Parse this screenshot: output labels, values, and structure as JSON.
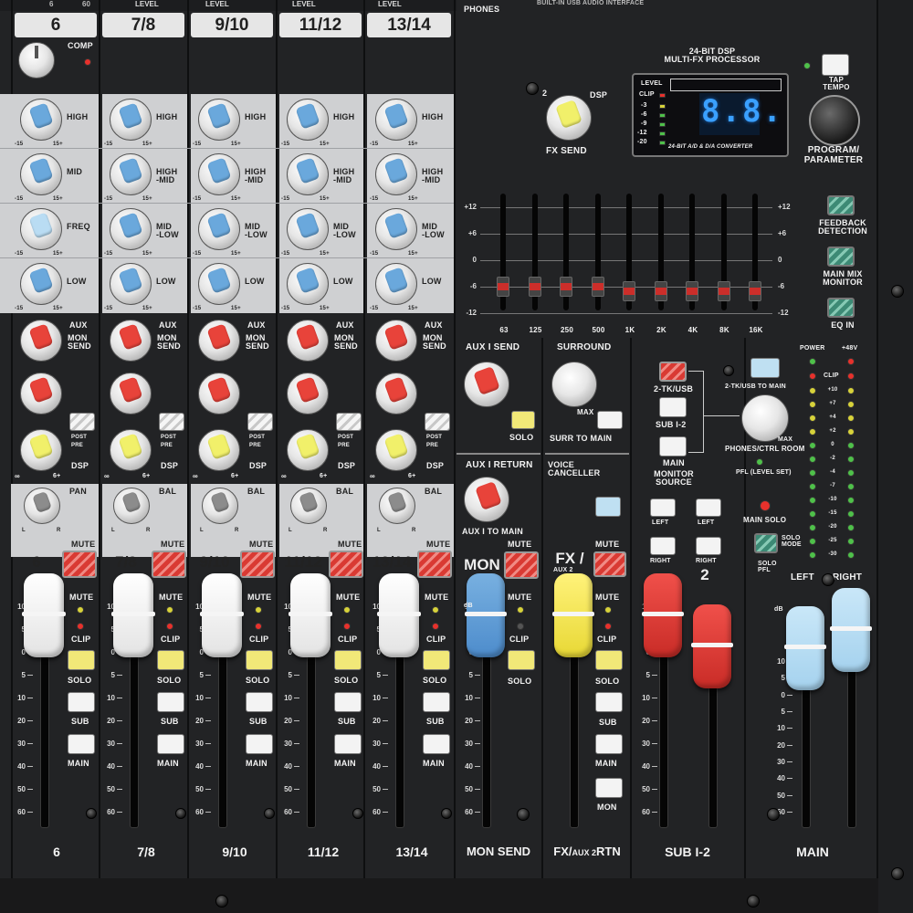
{
  "top": {
    "level_label": "LEVEL",
    "phones_label": "PHONES",
    "usb_label": "BUILT-IN USB AUDIO INTERFACE",
    "top_numbers": [
      "6",
      "60"
    ]
  },
  "channels": [
    {
      "header": "6",
      "number": "6",
      "footer": "6",
      "pan_label": "PAN",
      "pan_hint": "",
      "fader_color": "white"
    },
    {
      "header": "7/8",
      "number": "7/8",
      "footer": "7/8",
      "pan_label": "BAL",
      "pan_hint": "",
      "fader_color": "white"
    },
    {
      "header": "9/10",
      "number": "9/10",
      "footer": "9/10",
      "pan_label": "BAL",
      "pan_hint": "",
      "fader_color": "white"
    },
    {
      "header": "11/12",
      "number": "11/12",
      "footer": "11/12",
      "pan_label": "BAL",
      "pan_hint": "",
      "fader_color": "white"
    },
    {
      "header": "13/14",
      "number": "13/14",
      "footer": "13/14",
      "pan_label": "BAL",
      "pan_hint": "",
      "fader_color": "white"
    }
  ],
  "channel_labels": {
    "comp": "COMP",
    "high": "HIGH",
    "high_mid": "HIGH\n-MID",
    "mid": "MID",
    "mid_low": "MID\n-LOW",
    "freq": "FREQ",
    "low": "LOW",
    "aux": "AUX",
    "mon_send": "MON\nSEND",
    "post": "POST",
    "pre": "PRE",
    "dsp": "DSP",
    "mute": "MUTE",
    "clip": "CLIP",
    "solo": "SOLO",
    "sub": "SUB",
    "main": "MAIN",
    "range_low": "-15",
    "range_high": "15+",
    "lr_left": "L",
    "lr_right": "R",
    "inf": "∞",
    "plus6": "6+"
  },
  "fader_scale": [
    "10",
    "5",
    "0",
    "5",
    "10",
    "20",
    "30",
    "40",
    "50",
    "60"
  ],
  "dsp": {
    "title": "24-BIT DSP\nMULTI-FX PROCESSOR",
    "display": "8.8.",
    "level_label": "LEVEL",
    "clip_label": "CLIP",
    "meter_labels": [
      "-3",
      "-6",
      "-9",
      "-12",
      "-20"
    ],
    "converter_label": "24-BIT A/D & D/A CONVERTER",
    "fx_send_label": "FX SEND",
    "fx_send_range": [
      "2",
      "DSP"
    ],
    "tap_tempo": "TAP\nTEMPO",
    "program": "PROGRAM/\nPARAMETER"
  },
  "geq": {
    "scale": [
      "+12",
      "+6",
      "0",
      "-6",
      "-12"
    ],
    "bands": [
      "63",
      "125",
      "250",
      "500",
      "1K",
      "2K",
      "4K",
      "8K",
      "16K"
    ],
    "levels_db": [
      -7,
      -7,
      -7,
      -7,
      -8,
      -8,
      -8,
      -8,
      -8
    ]
  },
  "switches": {
    "feedback": "FEEDBACK\nDETECTION",
    "main_mix": "MAIN MIX\nMONITOR",
    "eq_in": "EQ IN"
  },
  "masters": {
    "aux1_send": "AUX I SEND",
    "solo": "SOLO",
    "aux1_return": "AUX I RETURN",
    "aux1_to_main": "AUX I TO MAIN",
    "mon": "MON",
    "surround": "SURROUND",
    "max": "MAX",
    "surr_to_main": "SURR TO MAIN",
    "voice_canceller": "VOICE\nCANCELLER",
    "fx_aux2": "FX /",
    "aux2_small": "AUX 2",
    "mon_button": "MON",
    "two_tk_usb": "2-TK/USB",
    "sub12": "SUB I-2",
    "main_btn": "MAIN",
    "monitor_source": "MONITOR\nSOURCE",
    "left": "LEFT",
    "right": "RIGHT",
    "sub_number": "2",
    "two_tk_to_main": "2-TK/USB TO MAIN",
    "phones_ctrl": "PHONES/CTRL ROOM",
    "pfl": "PFL (LEVEL SET)",
    "main_solo": "MAIN SOLO",
    "solo_mode": "SOLO\nMODE",
    "solo_pfl": "SOLO\nPFL",
    "power": "POWER",
    "phantom": "+48V",
    "clip": "CLIP",
    "meter_left": "LEFT",
    "meter_right": "RIGHT",
    "meter_scale": [
      "+10",
      "+7",
      "+4",
      "+2",
      "0",
      "-2",
      "-4",
      "-7",
      "-10",
      "-15",
      "-20",
      "-25",
      "-30"
    ],
    "db": "dB",
    "footers": {
      "mon": "MON SEND",
      "fx": "FX/AUX2 RTN",
      "fx_main": "FX/",
      "fx_small": "AUX 2",
      "fx_tail": "RTN",
      "sub": "SUB I-2",
      "main": "MAIN"
    }
  },
  "colors": {
    "panel": "#222325",
    "eq_section": "#cfd0d2",
    "display_blue": "#3aa0ff",
    "mute_red": "#d93a33",
    "aux_red": "#e8433a",
    "dsp_yellow": "#f1f06a",
    "eq_blue": "#6aa8dc"
  }
}
